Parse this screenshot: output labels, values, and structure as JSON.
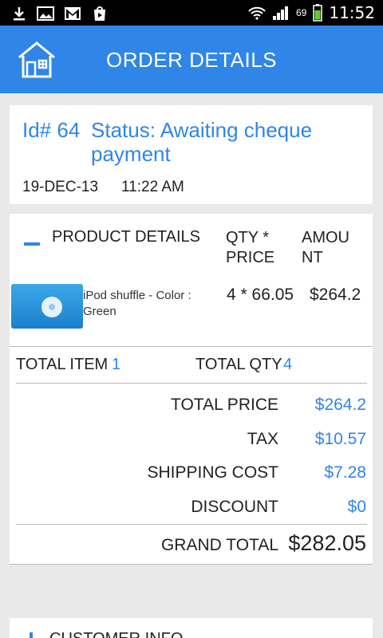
{
  "status_bar": {
    "battery_pct": "69",
    "clock": "11:52",
    "notification_icons": [
      "download-icon",
      "image-icon",
      "gmail-icon",
      "store-icon"
    ]
  },
  "header": {
    "title": "ORDER DETAILS",
    "accent_color": "#2f86e8"
  },
  "order": {
    "id_label": "Id# 64",
    "status": "Status: Awaiting cheque payment",
    "date": "19-DEC-13",
    "time": "11:22 AM"
  },
  "products": {
    "header_product": "PRODUCT DETAILS",
    "header_qty": "QTY * PRICE",
    "header_amount": "AMOUNT",
    "items": [
      {
        "name": "iPod shuffle - Color : Green",
        "qty_price": "4 * 66.05",
        "amount": "$264.2"
      }
    ]
  },
  "totals": {
    "total_item_label": "TOTAL ITEM",
    "total_item_value": "1",
    "total_qty_label": "TOTAL QTY",
    "total_qty_value": "4",
    "total_price_label": "TOTAL PRICE",
    "total_price_value": "$264.2",
    "tax_label": "TAX",
    "tax_value": "$10.57",
    "shipping_label": "SHIPPING COST",
    "shipping_value": "$7.28",
    "discount_label": "DISCOUNT",
    "discount_value": "$0",
    "grand_total_label": "GRAND TOTAL",
    "grand_total_value": "$282.05"
  },
  "customer": {
    "section_label": "CUSTOMER INFO"
  }
}
